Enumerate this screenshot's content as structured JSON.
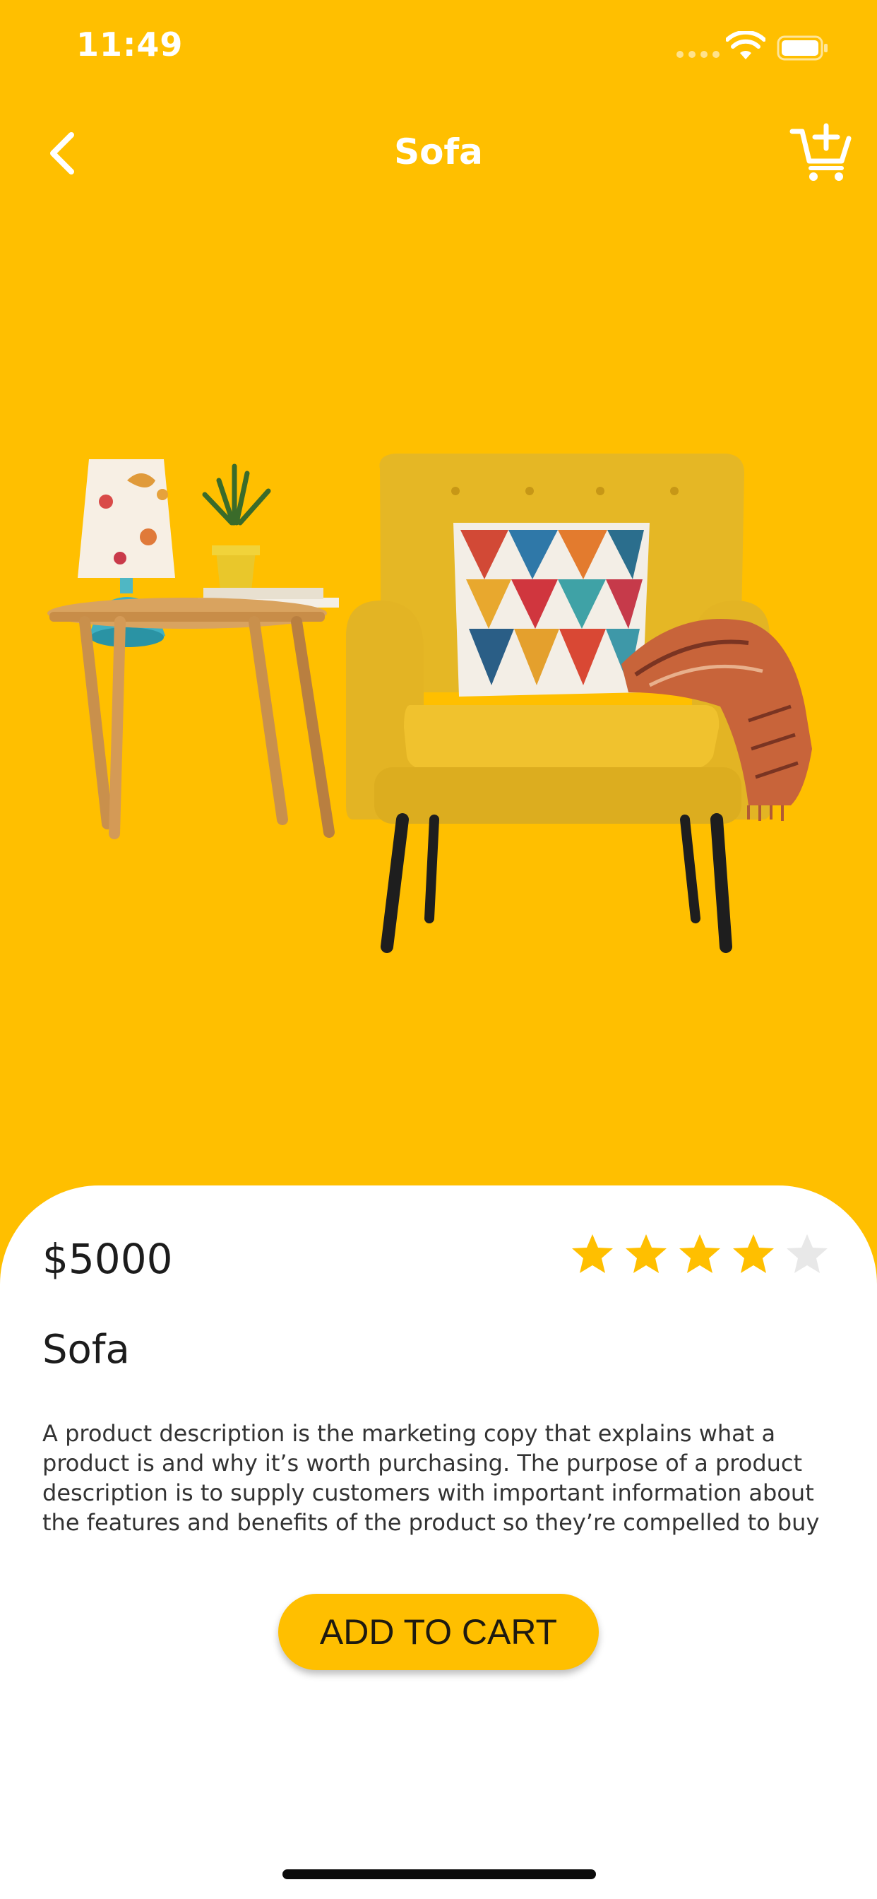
{
  "status_bar": {
    "time": "11:49"
  },
  "header": {
    "title": "Sofa",
    "back_icon": "chevron-left-icon",
    "cart_icon": "cart-plus-icon"
  },
  "product": {
    "price": "$5000",
    "rating": 4,
    "rating_max": 5,
    "name": "Sofa",
    "description": "A product description is the marketing copy that explains what a product is and why it’s worth purchasing. The purpose of a product description is to supply customers with important information about the features and benefits of the product so they’re compelled to buy",
    "add_to_cart_label": "ADD TO CART"
  },
  "colors": {
    "accent": "#FFBF00",
    "star_filled": "#FFBF00",
    "star_empty": "#E8E8E8",
    "sheet": "#FFFFFF"
  }
}
